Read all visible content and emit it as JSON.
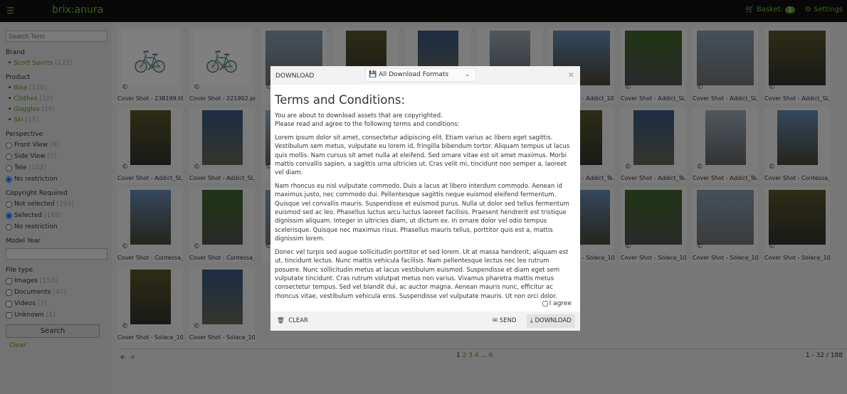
{
  "header": {
    "menu_icon": "hamburger-icon",
    "brand": "brix:anura",
    "basket_label": "Basket:",
    "basket_count": "1",
    "settings_label": "Settings"
  },
  "sidebar": {
    "search_placeholder": "Search Term",
    "brand_title": "Brand",
    "brands": [
      {
        "label": "Scott Sports",
        "count": "[122]"
      }
    ],
    "product_title": "Product",
    "products": [
      {
        "label": "Bike",
        "count": "[120]"
      },
      {
        "label": "Clothes",
        "count": "[19]"
      },
      {
        "label": "Goggles",
        "count": "[16]"
      },
      {
        "label": "Ski",
        "count": "[15]"
      }
    ],
    "perspective_title": "Perspective",
    "perspectives": [
      {
        "label": "Front View",
        "count": "[8]"
      },
      {
        "label": "Side View",
        "count": "[5]"
      },
      {
        "label": "Tele",
        "count": "[102]"
      },
      {
        "label": "No restriction",
        "count": "",
        "checked": true
      }
    ],
    "copyright_title": "Copyright Required",
    "copyright": [
      {
        "label": "Not selected",
        "count": "[294]"
      },
      {
        "label": "Selected",
        "count": "[188]",
        "checked": true
      },
      {
        "label": "No restriction",
        "count": ""
      }
    ],
    "model_year_title": "Model Year",
    "model_year_value": "",
    "filetype_title": "File type",
    "filetypes": [
      {
        "label": "Images",
        "count": "[133]"
      },
      {
        "label": "Documents",
        "count": "[47]"
      },
      {
        "label": "Videos",
        "count": "[7]"
      },
      {
        "label": "Unknown",
        "count": "[1]"
      }
    ],
    "search_button": "Search",
    "clear_link": "Clear"
  },
  "grid": {
    "rows": [
      [
        "Cover Shot - 238199.tif",
        "Cover Shot - 221902.png",
        "",
        "",
        "",
        "",
        "Cover Shot - Addict_10...",
        "Cover Shot - Addict_SL_...",
        "Cover Shot - Addict_SL_...",
        "Cover Shot - Addict_SL_..."
      ],
      [
        "Cover Shot - Addict_SL_...",
        "Cover Shot - Addict_SL_...",
        "",
        "",
        "",
        "",
        "Cover Shot - Addict_Te...",
        "Cover Shot - Addict_Te...",
        "Cover Shot - Addict_Te...",
        "Cover Shot - Contessa_..."
      ],
      [
        "Cover Shot - Contessa_...",
        "Cover Shot - Contessa_...",
        "",
        "",
        "",
        "",
        "Cover Shot - Solace_10...",
        "Cover Shot - Solace_10...",
        "Cover Shot - Solace_10...",
        "Cover Shot - Solace_10..."
      ],
      [
        "Cover Shot - Solace_10...",
        "Cover Shot - Solace_10..."
      ]
    ]
  },
  "pager": {
    "prev_icon": "arrow-left-icon",
    "next_icon": "arrow-right-icon",
    "current": "1",
    "pages": [
      "2",
      "3",
      "4"
    ],
    "ellipsis": "...",
    "last": "6",
    "range": "1 - 32 / 188"
  },
  "modal": {
    "title": "DOWNLOAD",
    "format_select": "All Download Formats",
    "heading": "Terms and Conditions:",
    "intro1": "You are about to download assets that are copyrighted.",
    "intro2": "Please read and agree to the following terms and conditions:",
    "paragraphs": [
      "Lorem ipsum dolor sit amet, consectetur adipiscing elit. Etiam varius ac libero eget sagittis. Vestibulum sem metus, vulputate eu lorem id, fringilla bibendum tortor. Aliquam tempus ut lacus quis mollis. Nam cursus sit amet nulla at eleifend. Sed ornare vitae est sit amet maximus. Morbi mattis convallis sapien, a sagittis urna ultricies ut. Cras velit mi, tincidunt non semper a, laoreet vel diam.",
      "Nam rhoncus eu nisl vulputate commodo. Duis a lacus at libero interdum commodo. Aenean id maximus justo, nec commodo dui. Pellentesque sagittis neque euismod eleifend fermentum. Quisque vel convallis mauris. Suspendisse et euismod purus. Nulla ut dolor sed tellus fermentum euismod sed ac leo. Phasellus luctus arcu luctus laoreet facilisis. Praesent hendrerit est tristique dignissim aliquam. Integer in ultricies diam, ut dictum ex. In ornare dolor vel odio tempus scelerisque. Quisque nec maximus risus. Phasellus mauris tellus, porttitor quis est a, mattis dignissim lorem.",
      "Donec vel turpis sed augue sollicitudin porttitor et sed lorem. Ut at massa hendrerit, aliquam est ut, tincidunt lectus. Nunc mattis vehicula facilisis. Nam pellentesque lectus nec leo rutrum posuere. Nunc sollicitudin metus at lacus vestibulum euismod. Suspendisse et diam eget sem vulputate tincidunt. Cras rutrum volutpat metus non varius. Vivamus pharetra mattis metus consectetur tempus. Sed vel blandit dui, ac auctor magna. Aenean mauris nunc, efficitur ac rhoncus vitae, vestibulum vehicula eros. Suspendisse vel vulputate mauris. Ut non orci dolor. Donec placerat risus vel urna rhoncus lacinia. Curabitur semper turpis eget diam malesuada iaculis. Donec id pharetra est, et venenatis sapien. Maecenas nec enim vel lorem egestas ullamcorper."
    ],
    "agree_label": "I agree",
    "clear_label": "CLEAR",
    "send_label": "SEND",
    "download_label": "DOWNLOAD"
  },
  "colors": {
    "accent": "#6fc52b",
    "header_bg": "#111111"
  }
}
